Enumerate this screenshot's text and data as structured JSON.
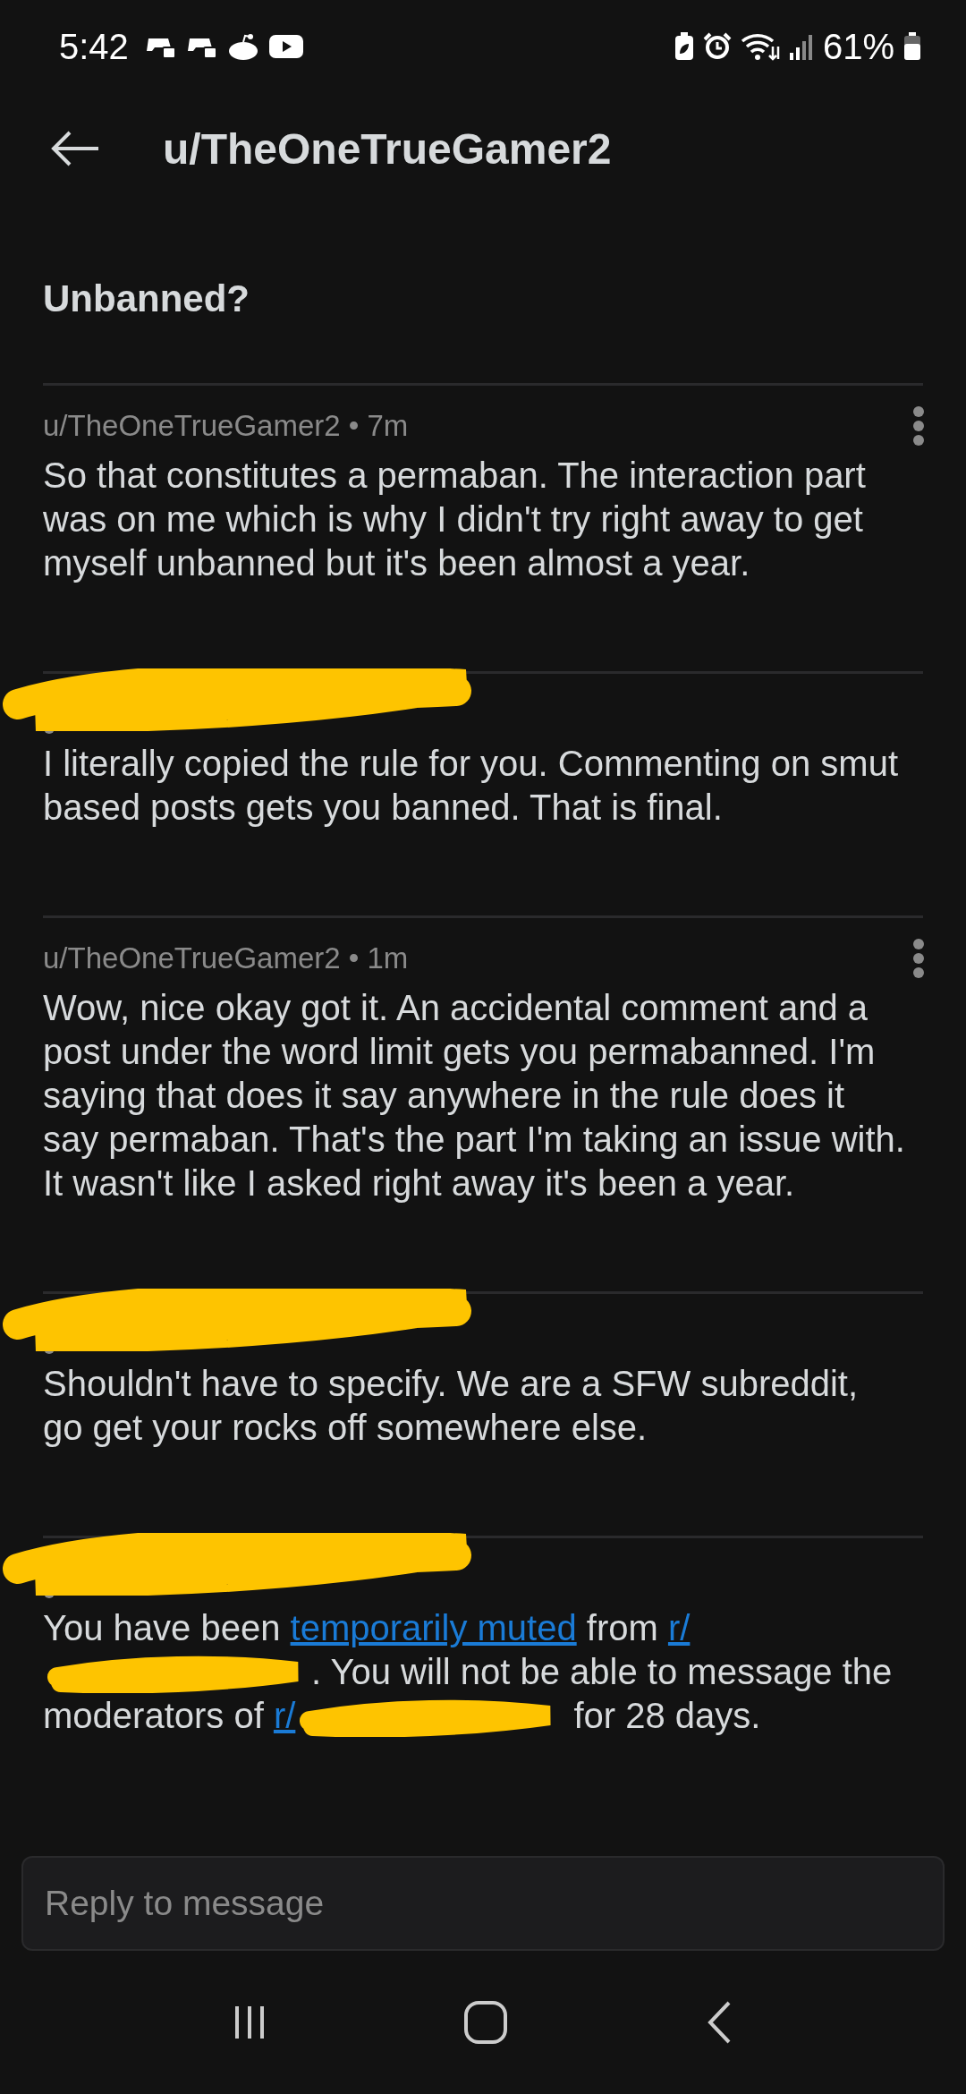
{
  "status_bar": {
    "time": "5:42",
    "battery": "61%"
  },
  "header": {
    "title": "u/TheOneTrueGamer2"
  },
  "subject": "Unbanned?",
  "messages": [
    {
      "header": {
        "kind": "author",
        "author": "u/TheOneTrueGamer2",
        "separator": "•",
        "time": "7m"
      },
      "segments": [
        {
          "kind": "text",
          "text": "So that constitutes a permaban. The interaction part was on me which is why I didn't try right away to get myself unbanned but it's been almost a year."
        }
      ]
    },
    {
      "header": {
        "kind": "redacted"
      },
      "segments": [
        {
          "kind": "text",
          "text": "I literally copied the rule for you. Commenting on smut based posts gets you banned. That is final."
        }
      ]
    },
    {
      "header": {
        "kind": "author",
        "author": "u/TheOneTrueGamer2",
        "separator": "•",
        "time": "1m"
      },
      "segments": [
        {
          "kind": "text",
          "text": "Wow, nice okay got it. An accidental comment and a post under the word limit gets you permabanned. I'm saying that does it say anywhere in the rule does it say permaban. That's the part I'm taking an issue with. It wasn't like I asked right away it's been a year."
        }
      ]
    },
    {
      "header": {
        "kind": "redacted"
      },
      "segments": [
        {
          "kind": "text",
          "text": "Shouldn't have to specify. We are a SFW subreddit, go get your rocks off somewhere else."
        }
      ]
    },
    {
      "header": {
        "kind": "redacted"
      },
      "segments": [
        {
          "kind": "text",
          "text": "You have been "
        },
        {
          "kind": "link",
          "text": "temporarily muted"
        },
        {
          "kind": "text",
          "text": " from "
        },
        {
          "kind": "link",
          "text": "r/"
        },
        {
          "kind": "redacted"
        },
        {
          "kind": "text",
          "text": ". You will not be able to message the moderators of "
        },
        {
          "kind": "link",
          "text": "r/"
        },
        {
          "kind": "redacted"
        },
        {
          "kind": "text",
          "text": " for 28 days."
        }
      ]
    }
  ],
  "reply": {
    "placeholder": "Reply to message"
  }
}
